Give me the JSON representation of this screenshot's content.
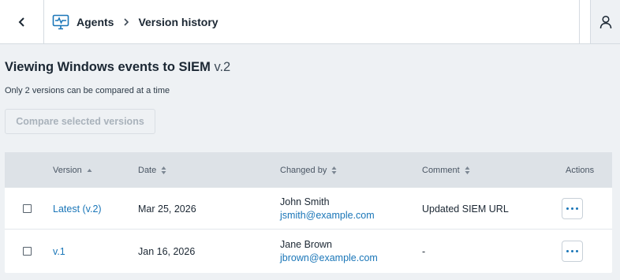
{
  "header": {
    "app_icon": "monitor-pulse-icon",
    "breadcrumb": [
      "Agents",
      "Version history"
    ],
    "back_icon": "chevron-left-icon",
    "user_icon": "user-icon"
  },
  "page": {
    "title": "Viewing Windows events to SIEM",
    "version": "v.2",
    "hint": "Only 2 versions can be compared at a time",
    "compare_label": "Compare selected versions"
  },
  "table": {
    "columns": [
      "Version",
      "Date",
      "Changed by",
      "Comment",
      "Actions"
    ],
    "rows": [
      {
        "version": "Latest (v.2)",
        "date": "Mar 25, 2026",
        "name": "John Smith",
        "email": "jsmith@example.com",
        "comment": "Updated SIEM URL"
      },
      {
        "version": "v.1",
        "date": "Jan 16, 2026",
        "name": "Jane Brown",
        "email": "jbrown@example.com",
        "comment": "-"
      }
    ]
  },
  "colors": {
    "accent": "#1a76b8",
    "header_bg": "#dde2e7",
    "page_bg": "#eef1f4"
  }
}
